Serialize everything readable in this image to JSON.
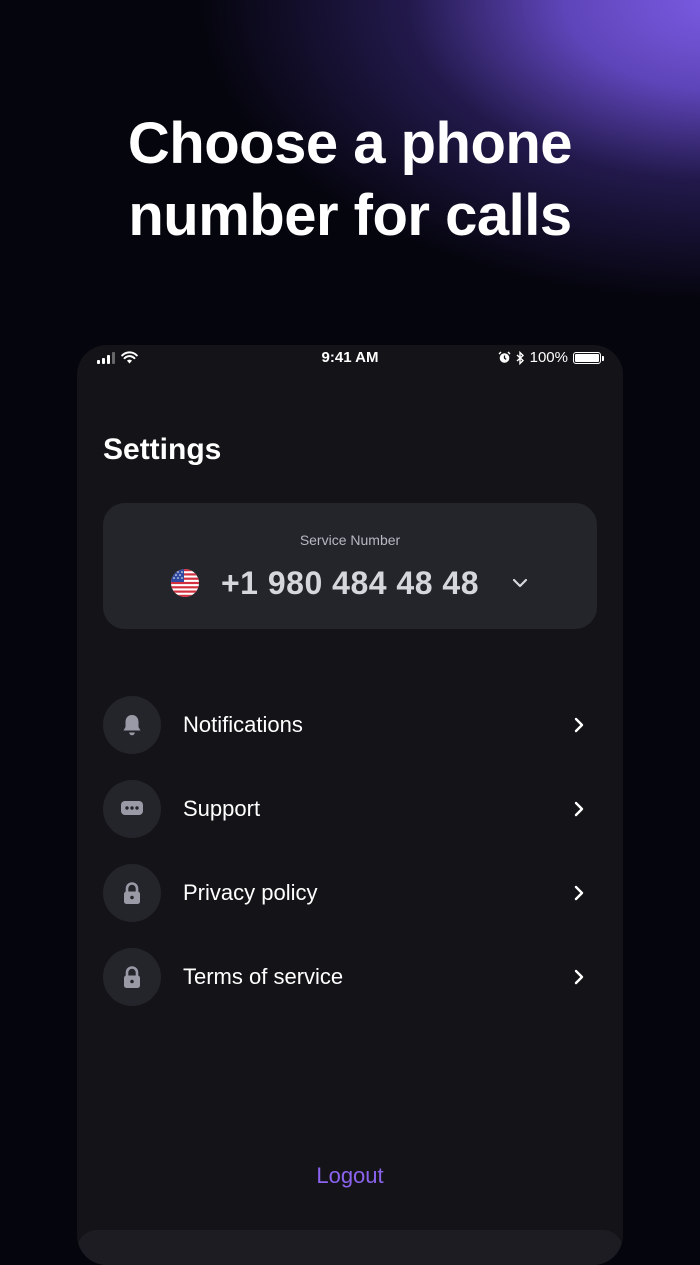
{
  "headline": {
    "line1": "Choose a phone",
    "line2": "number for calls"
  },
  "status_bar": {
    "time": "9:41 AM",
    "battery": "100%"
  },
  "settings": {
    "title": "Settings",
    "service": {
      "label": "Service Number",
      "number": "+1 980 484 48 48",
      "flag": "us-flag"
    },
    "menu": [
      {
        "label": "Notifications",
        "icon": "bell-icon"
      },
      {
        "label": "Support",
        "icon": "chat-bubble-icon"
      },
      {
        "label": "Privacy policy",
        "icon": "lock-icon"
      },
      {
        "label": "Terms of service",
        "icon": "lock-icon"
      }
    ],
    "logout": "Logout"
  },
  "colors": {
    "accent": "#8b63ee",
    "background": "#05050e",
    "panel": "#141418",
    "card": "#24242b"
  }
}
